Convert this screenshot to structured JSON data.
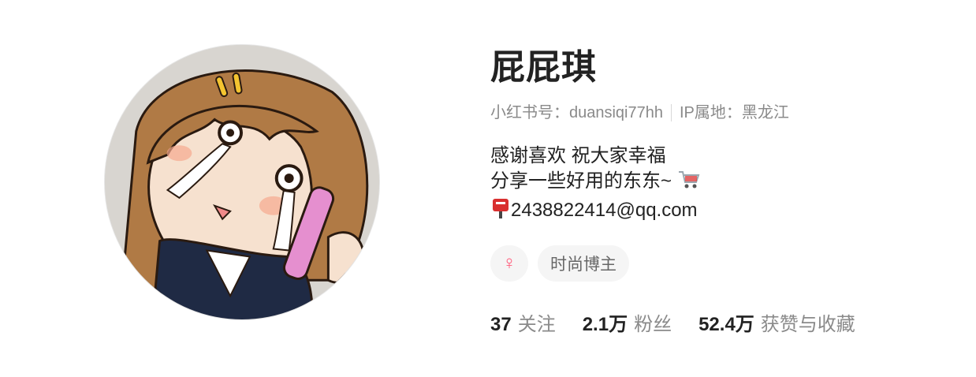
{
  "profile": {
    "nickname": "屁屁琪",
    "id_label": "小红书号：",
    "id_value": "duansiqi77hh",
    "ip_label": "IP属地：",
    "ip_value": "黑龙江",
    "bio_lines": [
      "感谢喜欢 祝大家幸福",
      "分享一些好用的东东~",
      "2438822414@qq.com"
    ],
    "gender_symbol": "♀",
    "tags": [
      "时尚博主"
    ],
    "stats": [
      {
        "num": "37",
        "label": "关注"
      },
      {
        "num": "2.1万",
        "label": "粉丝"
      },
      {
        "num": "52.4万",
        "label": "获赞与收藏"
      }
    ]
  },
  "icons": {
    "avatar": "cartoon-girl-avatar",
    "cart": "shopping-cart-icon",
    "postbox": "postbox-icon",
    "gender": "female-icon"
  },
  "colors": {
    "gender_accent": "#ff5a7a",
    "tag_bg": "#f5f5f5",
    "meta_text": "#8a8a8a"
  }
}
